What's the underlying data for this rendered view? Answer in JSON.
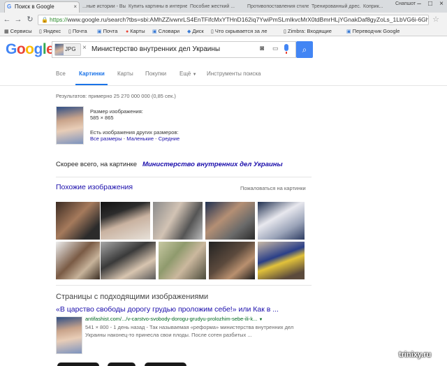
{
  "browser": {
    "tab_title": "Поиск в Google",
    "ghost_tabs": [
      "...ные истории - Выстре...",
      "Купить картины в интернет-...",
      "Пособие жесткий ...",
      "Противопоставления стилей ...",
      "Тренированный дрес...",
      "Коприк..."
    ],
    "window_label": "Снапшот",
    "url_scheme": "https://",
    "url_rest": "www.google.ru/search?tbs=sbi:AMhZZivwnrLS4EnTFifcMxYTHnD162iq7YwiPmSLmIkvcMrX0tdBmrHLjYGnakDaf8gyZoLs_1LbVG6i-6Gha0cNOCwhMr",
    "bookmarks": [
      "Сервисы",
      "Яндекс",
      "Почта",
      "Почта",
      "Карты",
      "Словари",
      "Диск",
      "Что скрывается за ле",
      "Zimbra: Входящие",
      "Переводчик Google"
    ]
  },
  "search": {
    "logo": [
      "G",
      "o",
      "o",
      "g",
      "l",
      "e"
    ],
    "chip_label": "JPG",
    "query": "Министерство внутренних дел Украины"
  },
  "tabs": [
    {
      "label": "Все",
      "active": false
    },
    {
      "label": "Картинки",
      "active": true
    },
    {
      "label": "Карты",
      "active": false
    },
    {
      "label": "Покупки",
      "active": false
    },
    {
      "label": "Ещё",
      "active": false
    },
    {
      "label": "Инструменты поиска",
      "active": false
    }
  ],
  "results": {
    "stats": "Результатов: примерно 25 270 000 000 (0,85 сек.)",
    "size_label": "Размер изображения:",
    "size_value": "585 × 865",
    "other_sizes_label": "Есть изображения других размеров:",
    "size_links": [
      "Все размеры",
      "Маленькие",
      "Средние"
    ],
    "best_guess_label": "Скорее всего, на картинке",
    "best_guess_link": "Министерство внутренних дел Украины"
  },
  "similar": {
    "title": "Похожие изображения",
    "report": "Пожаловаться на картинки"
  },
  "pages": {
    "title": "Страницы с подходящими изображениями",
    "result_title": "«В царство свободы дорогу грудью проложим себе!» или Как в ...",
    "result_url": "antifashist.com/.../v-carstvo-svobody-dorogu-grudyu-prolozhim-sebe-ili-k...",
    "snippet_1": "541 × 800 - 1 день назад - Так называемая «реформа» министерства внутренних дел",
    "snippet_2": "Украины наконец-то принесла свои плоды. После сотен разбитых ..."
  },
  "watermark": "trinixy.ru",
  "colors": {
    "accent": "#4285f4",
    "link": "#1a0dab",
    "url_green": "#006621"
  },
  "icons": [
    "back-arrow-icon",
    "forward-arrow-icon",
    "reload-icon",
    "lock-icon",
    "star-icon",
    "camera-icon",
    "keyboard-icon",
    "microphone-icon",
    "search-icon"
  ]
}
